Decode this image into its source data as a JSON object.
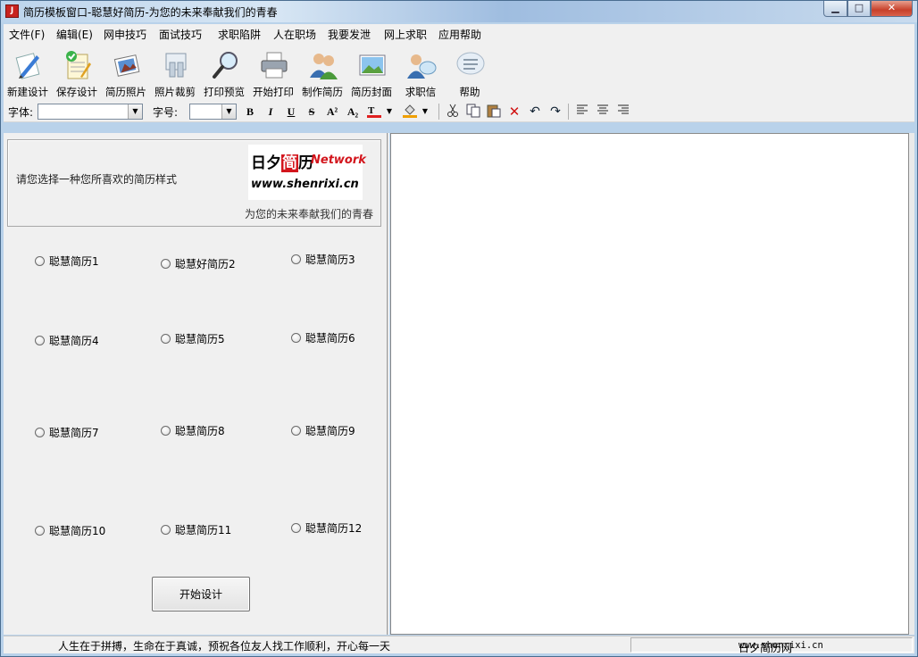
{
  "window": {
    "title": "简历模板窗口-聪慧好简历-为您的未来奉献我们的青春",
    "minimize": "▁",
    "maximize": "□",
    "close": "✕"
  },
  "menu": [
    "文件(F)",
    "编辑(E)",
    "网申技巧",
    "面试技巧",
    "求职陷阱",
    "人在职场",
    "我要发泄",
    "网上求职",
    "应用帮助"
  ],
  "toolbar": [
    {
      "label": "新建设计",
      "icon": "new-design-icon"
    },
    {
      "label": "保存设计",
      "icon": "save-design-icon"
    },
    {
      "label": "简历照片",
      "icon": "photo-icon"
    },
    {
      "label": "照片裁剪",
      "icon": "crop-icon"
    },
    {
      "label": "打印预览",
      "icon": "print-preview-icon"
    },
    {
      "label": "开始打印",
      "icon": "printer-icon"
    },
    {
      "label": "制作简历",
      "icon": "people-icon"
    },
    {
      "label": "简历封面",
      "icon": "cover-image-icon"
    },
    {
      "label": "求职信",
      "icon": "chat-people-icon"
    },
    {
      "label": "帮助",
      "icon": "help-bubble-icon"
    }
  ],
  "format": {
    "font_label": "字体:",
    "font_value": "",
    "size_label": "字号:",
    "size_value": "",
    "bold": "B",
    "italic": "I",
    "underline": "U",
    "strike": "S",
    "superscript": "A²",
    "subscript": "A₂"
  },
  "panel": {
    "prompt": "请您选择一种您所喜欢的简历样式",
    "logo_line1_a": "日夕",
    "logo_line1_b": "简",
    "logo_line1_c": "历",
    "logo_net": "Network",
    "logo_url": "www.shenrixi.cn",
    "slogan": "为您的未来奉献我们的青春",
    "options": [
      "聪慧简历1",
      "聪慧好简历2",
      "聪慧简历3",
      "聪慧简历4",
      "聪慧简历5",
      "聪慧简历6",
      "聪慧简历7",
      "聪慧简历8",
      "聪慧简历9",
      "聪慧简历10",
      "聪慧简历11",
      "聪慧简历12"
    ],
    "start_button": "开始设计"
  },
  "status": {
    "left": "人生在于拼搏，生命在于真诚，预祝各位友人找工作顺利，开心每一天",
    "right_name": "日夕简历网",
    "right_url": "www.shenrixi.cn"
  }
}
